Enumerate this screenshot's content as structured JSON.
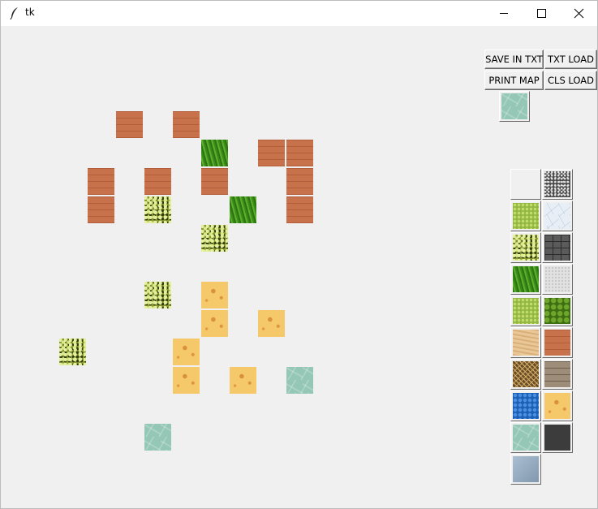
{
  "window": {
    "title": "tk"
  },
  "toolbar": {
    "save_label": "SAVE IN TXT",
    "txt_load_label": "TXT LOAD",
    "print_map_label": "PRINT MAP",
    "cls_load_label": "CLS LOAD"
  },
  "selected_tile": "water",
  "palette": [
    "blank",
    "granite",
    "lightgreen",
    "ice",
    "moss",
    "stonewall",
    "grass",
    "snow",
    "lightgreen",
    "leaves",
    "sand",
    "brick",
    "straw",
    "planks",
    "bluewater",
    "cheese",
    "water",
    "dark",
    "steel"
  ],
  "map_tiles": [
    {
      "texture": "brick",
      "col": 4,
      "row": 3
    },
    {
      "texture": "brick",
      "col": 6,
      "row": 3
    },
    {
      "texture": "grass",
      "col": 7,
      "row": 4
    },
    {
      "texture": "brick",
      "col": 9,
      "row": 4
    },
    {
      "texture": "brick",
      "col": 10,
      "row": 4
    },
    {
      "texture": "brick",
      "col": 3,
      "row": 5
    },
    {
      "texture": "brick",
      "col": 5,
      "row": 5
    },
    {
      "texture": "brick",
      "col": 7,
      "row": 5
    },
    {
      "texture": "brick",
      "col": 10,
      "row": 5
    },
    {
      "texture": "brick",
      "col": 3,
      "row": 6
    },
    {
      "texture": "moss",
      "col": 5,
      "row": 6
    },
    {
      "texture": "grass",
      "col": 8,
      "row": 6
    },
    {
      "texture": "brick",
      "col": 10,
      "row": 6
    },
    {
      "texture": "moss",
      "col": 7,
      "row": 7
    },
    {
      "texture": "moss",
      "col": 5,
      "row": 9
    },
    {
      "texture": "cheese",
      "col": 7,
      "row": 9
    },
    {
      "texture": "cheese",
      "col": 7,
      "row": 10
    },
    {
      "texture": "cheese",
      "col": 9,
      "row": 10
    },
    {
      "texture": "moss",
      "col": 2,
      "row": 11
    },
    {
      "texture": "cheese",
      "col": 6,
      "row": 11
    },
    {
      "texture": "cheese",
      "col": 6,
      "row": 12
    },
    {
      "texture": "cheese",
      "col": 8,
      "row": 12
    },
    {
      "texture": "water",
      "col": 10,
      "row": 12
    },
    {
      "texture": "water",
      "col": 5,
      "row": 14
    }
  ]
}
